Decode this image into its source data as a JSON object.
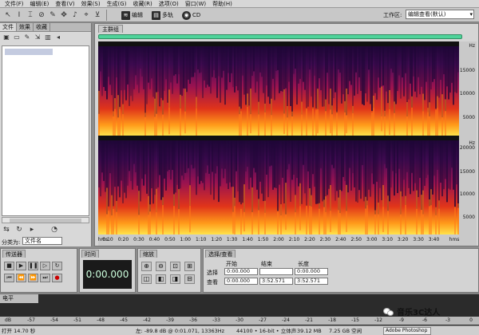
{
  "menubar": {
    "items": [
      "文件(F)",
      "编辑(E)",
      "查看(V)",
      "效果(S)",
      "生成(G)",
      "收藏(R)",
      "选项(O)",
      "窗口(W)",
      "帮助(H)"
    ]
  },
  "toolbar": {
    "edit_mode": "编辑",
    "multitrack_mode": "多轨",
    "cd_mode": "CD",
    "workspace_label": "工作区:",
    "workspace_value": "编辑查看(默认)"
  },
  "left_panel": {
    "tabs": [
      "文件",
      "效果",
      "收藏"
    ],
    "sort_label": "分类为:",
    "sort_value": "文件名"
  },
  "main_panel": {
    "tab_label": "主群组",
    "freq_unit": "Hz",
    "freq_ticks_top": [
      "15000",
      "10000",
      "5000"
    ],
    "freq_ticks_bottom": [
      "20000",
      "15000",
      "10000",
      "5000"
    ],
    "time_ticks": [
      "hms",
      "0:10",
      "0:20",
      "0:30",
      "0:40",
      "0:50",
      "1:00",
      "1:10",
      "1:20",
      "1:30",
      "1:40",
      "1:50",
      "2:00",
      "2:10",
      "2:20",
      "2:30",
      "2:40",
      "2:50",
      "3:00",
      "3:10",
      "3:20",
      "3:30",
      "3:40",
      "hms"
    ]
  },
  "transport": {
    "title": "传送器"
  },
  "time_panel": {
    "title": "时间",
    "value": "0:00.000"
  },
  "zoom_panel": {
    "title": "缩放"
  },
  "selection_panel": {
    "title": "选择/查看",
    "col_start": "开始",
    "col_end": "结束",
    "col_length": "长度",
    "row_selection": "选择",
    "row_view": "查看",
    "sel_start": "0:00.000",
    "sel_end": "",
    "sel_length": "0:00.000",
    "view_start": "0:00.000",
    "view_end": "3:52.571",
    "view_length": "3:52.571"
  },
  "level_panel": {
    "title": "电平",
    "db_ticks": [
      "dB",
      "-57",
      "-54",
      "-51",
      "-48",
      "-45",
      "-42",
      "-39",
      "-36",
      "-33",
      "-30",
      "-27",
      "-24",
      "-21",
      "-18",
      "-15",
      "-12",
      "-9",
      "-6",
      "-3",
      "0"
    ]
  },
  "status": {
    "open_time": "打开 14.70 秒",
    "cursor": "左: -89.8 dB @ 0:01.071, 13363Hz",
    "format": "44100 • 16-bit • 立体声",
    "size": "39.12 MB",
    "free": "7.25 GB 空闲",
    "taskbar": "Adobe Photoshop"
  },
  "watermark": {
    "text": "音乐3C达人"
  },
  "colors": {
    "overview": "#4fd39a",
    "spectro_hot": "#ffd24a",
    "spectro_cold": "#2a0a4a"
  }
}
